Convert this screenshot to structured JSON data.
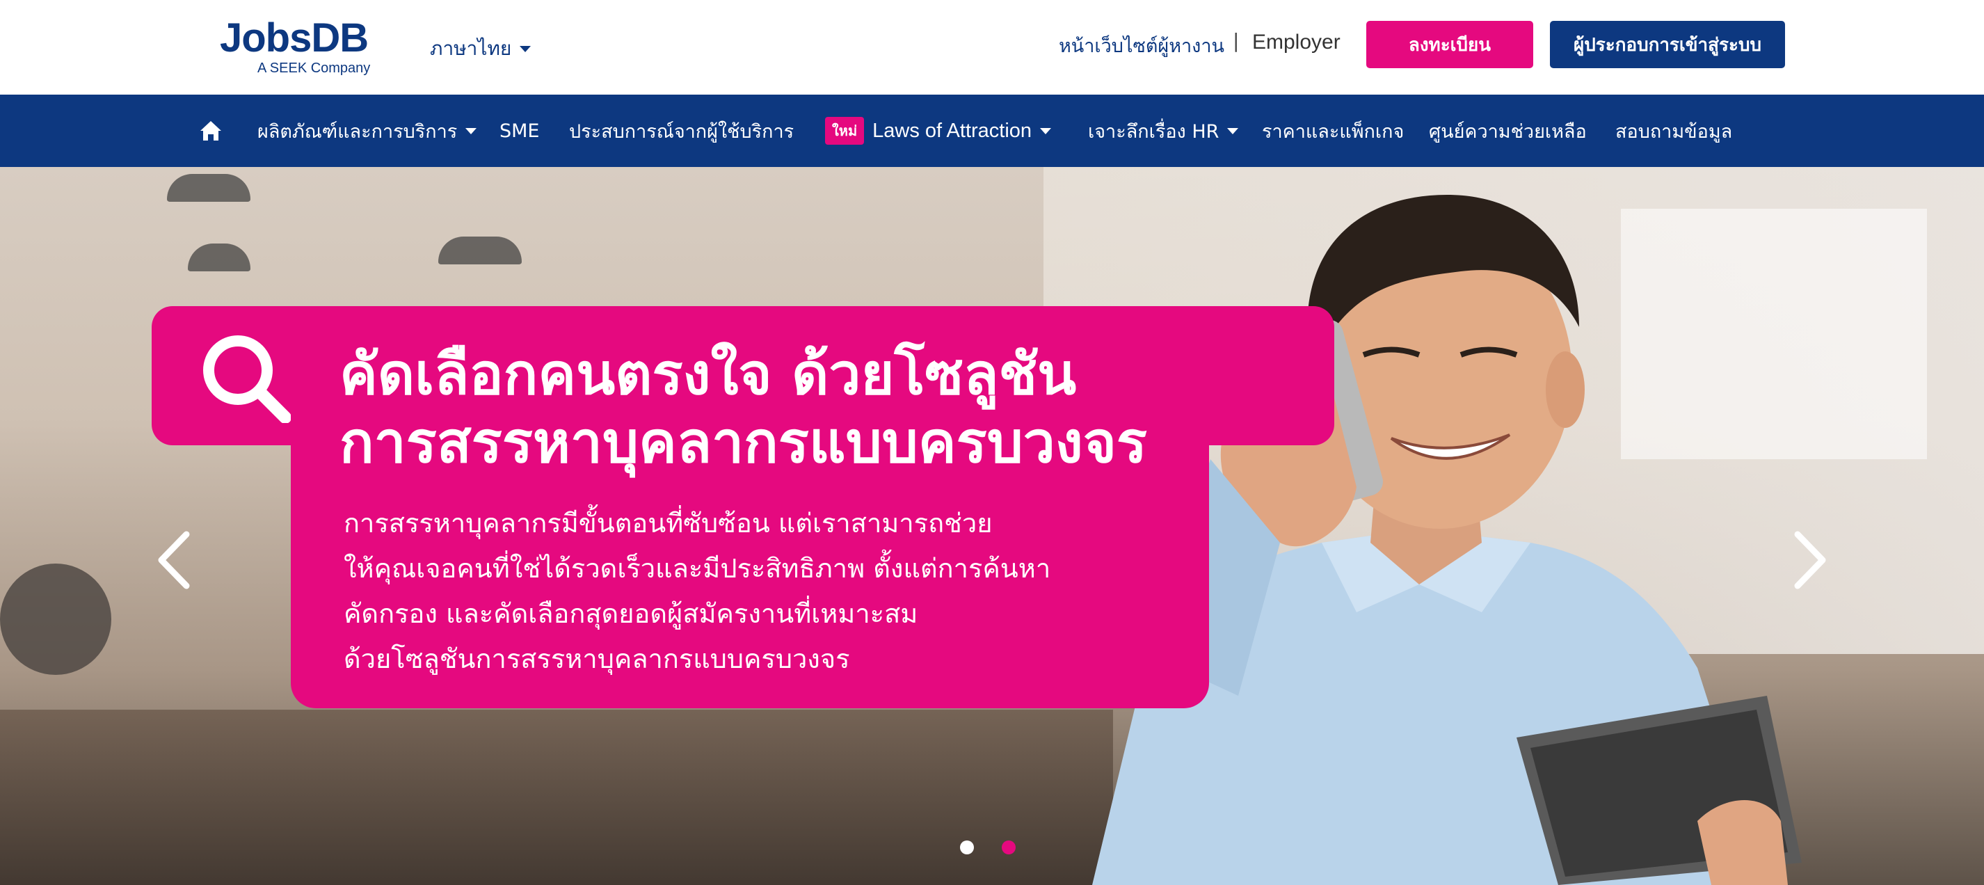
{
  "header": {
    "logo_text": "JobsDB",
    "logo_subtext": "A SEEK Company",
    "language_label": "ภาษาไทย",
    "jobseeker_link": "หน้าเว็บไซต์ผู้หางาน",
    "divider": "|",
    "employer_label": "Employer",
    "register_button": "ลงทะเบียน",
    "login_button": "ผู้ประกอบการเข้าสู่ระบบ"
  },
  "nav": {
    "home_icon": "home-icon",
    "items": [
      {
        "label": "ผลิตภัณฑ์และการบริการ",
        "dropdown": true
      },
      {
        "label": "SME",
        "dropdown": false
      },
      {
        "label": "ประสบการณ์จากผู้ใช้บริการ",
        "dropdown": false
      },
      {
        "label": "Laws of Attraction",
        "dropdown": true,
        "badge": "ใหม่"
      },
      {
        "label": "เจาะลึกเรื่อง HR",
        "dropdown": true
      },
      {
        "label": "ราคาและแพ็กเกจ",
        "dropdown": false
      },
      {
        "label": "ศูนย์ความช่วยเหลือ",
        "dropdown": false
      },
      {
        "label": "สอบถามข้อมูล",
        "dropdown": false
      }
    ]
  },
  "hero": {
    "headline_line1": "คัดเลือกคนตรงใจ ด้วยโซลูชัน",
    "headline_line2": "การสรรหาบุคลากรแบบครบวงจร",
    "body_lines": [
      "การสรรหาบุคลากรมีขั้นตอนที่ซับซ้อน แต่เราสามารถช่วย",
      "ให้คุณเจอคนที่ใช่ได้รวดเร็วและมีประสิทธิภาพ ตั้งแต่การค้นหา",
      "คัดกรอง และคัดเลือกสุดยอดผู้สมัครงานที่เหมาะสม",
      "ด้วยโซลูชันการสรรหาบุคลากรแบบครบวงจร"
    ],
    "carousel": {
      "total_slides": 2,
      "active_slide": 2
    }
  },
  "colors": {
    "brand_blue": "#0d3880",
    "brand_pink": "#e5097f",
    "white": "#ffffff"
  }
}
